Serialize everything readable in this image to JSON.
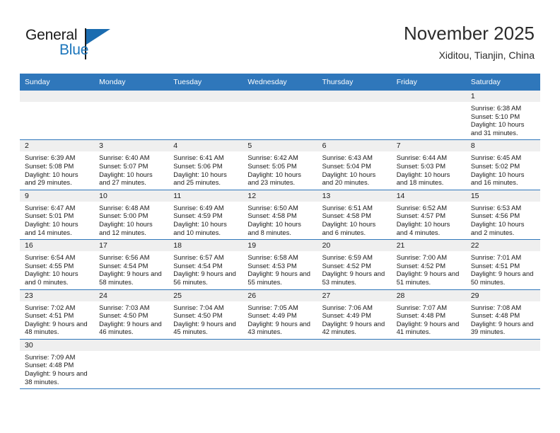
{
  "brand": {
    "line1": "General",
    "line2": "Blue",
    "flag_icon": "triangle-flag-icon",
    "color_text": "#1a1a1a",
    "color_blue": "#1b75bb"
  },
  "header": {
    "title": "November 2025",
    "subtitle": "Xiditou, Tianjin, China"
  },
  "theme": {
    "header_row_bg": "#2f77bb",
    "daynum_band_bg": "#efefef",
    "row_divider": "#2f77bb",
    "page_bg": "#ffffff"
  },
  "weekday_headers": [
    "Sunday",
    "Monday",
    "Tuesday",
    "Wednesday",
    "Thursday",
    "Friday",
    "Saturday"
  ],
  "labels": {
    "sunrise_prefix": "Sunrise:",
    "sunset_prefix": "Sunset:",
    "daylight_prefix": "Daylight:"
  },
  "weeks": [
    [
      {
        "blank": true,
        "day": "",
        "sunrise": "",
        "sunset": "",
        "daylight": ""
      },
      {
        "blank": true,
        "day": "",
        "sunrise": "",
        "sunset": "",
        "daylight": ""
      },
      {
        "blank": true,
        "day": "",
        "sunrise": "",
        "sunset": "",
        "daylight": ""
      },
      {
        "blank": true,
        "day": "",
        "sunrise": "",
        "sunset": "",
        "daylight": ""
      },
      {
        "blank": true,
        "day": "",
        "sunrise": "",
        "sunset": "",
        "daylight": ""
      },
      {
        "blank": true,
        "day": "",
        "sunrise": "",
        "sunset": "",
        "daylight": ""
      },
      {
        "blank": false,
        "day": "1",
        "sunrise": "Sunrise: 6:38 AM",
        "sunset": "Sunset: 5:10 PM",
        "daylight": "Daylight: 10 hours and 31 minutes."
      }
    ],
    [
      {
        "blank": false,
        "day": "2",
        "sunrise": "Sunrise: 6:39 AM",
        "sunset": "Sunset: 5:08 PM",
        "daylight": "Daylight: 10 hours and 29 minutes."
      },
      {
        "blank": false,
        "day": "3",
        "sunrise": "Sunrise: 6:40 AM",
        "sunset": "Sunset: 5:07 PM",
        "daylight": "Daylight: 10 hours and 27 minutes."
      },
      {
        "blank": false,
        "day": "4",
        "sunrise": "Sunrise: 6:41 AM",
        "sunset": "Sunset: 5:06 PM",
        "daylight": "Daylight: 10 hours and 25 minutes."
      },
      {
        "blank": false,
        "day": "5",
        "sunrise": "Sunrise: 6:42 AM",
        "sunset": "Sunset: 5:05 PM",
        "daylight": "Daylight: 10 hours and 23 minutes."
      },
      {
        "blank": false,
        "day": "6",
        "sunrise": "Sunrise: 6:43 AM",
        "sunset": "Sunset: 5:04 PM",
        "daylight": "Daylight: 10 hours and 20 minutes."
      },
      {
        "blank": false,
        "day": "7",
        "sunrise": "Sunrise: 6:44 AM",
        "sunset": "Sunset: 5:03 PM",
        "daylight": "Daylight: 10 hours and 18 minutes."
      },
      {
        "blank": false,
        "day": "8",
        "sunrise": "Sunrise: 6:45 AM",
        "sunset": "Sunset: 5:02 PM",
        "daylight": "Daylight: 10 hours and 16 minutes."
      }
    ],
    [
      {
        "blank": false,
        "day": "9",
        "sunrise": "Sunrise: 6:47 AM",
        "sunset": "Sunset: 5:01 PM",
        "daylight": "Daylight: 10 hours and 14 minutes."
      },
      {
        "blank": false,
        "day": "10",
        "sunrise": "Sunrise: 6:48 AM",
        "sunset": "Sunset: 5:00 PM",
        "daylight": "Daylight: 10 hours and 12 minutes."
      },
      {
        "blank": false,
        "day": "11",
        "sunrise": "Sunrise: 6:49 AM",
        "sunset": "Sunset: 4:59 PM",
        "daylight": "Daylight: 10 hours and 10 minutes."
      },
      {
        "blank": false,
        "day": "12",
        "sunrise": "Sunrise: 6:50 AM",
        "sunset": "Sunset: 4:58 PM",
        "daylight": "Daylight: 10 hours and 8 minutes."
      },
      {
        "blank": false,
        "day": "13",
        "sunrise": "Sunrise: 6:51 AM",
        "sunset": "Sunset: 4:58 PM",
        "daylight": "Daylight: 10 hours and 6 minutes."
      },
      {
        "blank": false,
        "day": "14",
        "sunrise": "Sunrise: 6:52 AM",
        "sunset": "Sunset: 4:57 PM",
        "daylight": "Daylight: 10 hours and 4 minutes."
      },
      {
        "blank": false,
        "day": "15",
        "sunrise": "Sunrise: 6:53 AM",
        "sunset": "Sunset: 4:56 PM",
        "daylight": "Daylight: 10 hours and 2 minutes."
      }
    ],
    [
      {
        "blank": false,
        "day": "16",
        "sunrise": "Sunrise: 6:54 AM",
        "sunset": "Sunset: 4:55 PM",
        "daylight": "Daylight: 10 hours and 0 minutes."
      },
      {
        "blank": false,
        "day": "17",
        "sunrise": "Sunrise: 6:56 AM",
        "sunset": "Sunset: 4:54 PM",
        "daylight": "Daylight: 9 hours and 58 minutes."
      },
      {
        "blank": false,
        "day": "18",
        "sunrise": "Sunrise: 6:57 AM",
        "sunset": "Sunset: 4:54 PM",
        "daylight": "Daylight: 9 hours and 56 minutes."
      },
      {
        "blank": false,
        "day": "19",
        "sunrise": "Sunrise: 6:58 AM",
        "sunset": "Sunset: 4:53 PM",
        "daylight": "Daylight: 9 hours and 55 minutes."
      },
      {
        "blank": false,
        "day": "20",
        "sunrise": "Sunrise: 6:59 AM",
        "sunset": "Sunset: 4:52 PM",
        "daylight": "Daylight: 9 hours and 53 minutes."
      },
      {
        "blank": false,
        "day": "21",
        "sunrise": "Sunrise: 7:00 AM",
        "sunset": "Sunset: 4:52 PM",
        "daylight": "Daylight: 9 hours and 51 minutes."
      },
      {
        "blank": false,
        "day": "22",
        "sunrise": "Sunrise: 7:01 AM",
        "sunset": "Sunset: 4:51 PM",
        "daylight": "Daylight: 9 hours and 50 minutes."
      }
    ],
    [
      {
        "blank": false,
        "day": "23",
        "sunrise": "Sunrise: 7:02 AM",
        "sunset": "Sunset: 4:51 PM",
        "daylight": "Daylight: 9 hours and 48 minutes."
      },
      {
        "blank": false,
        "day": "24",
        "sunrise": "Sunrise: 7:03 AM",
        "sunset": "Sunset: 4:50 PM",
        "daylight": "Daylight: 9 hours and 46 minutes."
      },
      {
        "blank": false,
        "day": "25",
        "sunrise": "Sunrise: 7:04 AM",
        "sunset": "Sunset: 4:50 PM",
        "daylight": "Daylight: 9 hours and 45 minutes."
      },
      {
        "blank": false,
        "day": "26",
        "sunrise": "Sunrise: 7:05 AM",
        "sunset": "Sunset: 4:49 PM",
        "daylight": "Daylight: 9 hours and 43 minutes."
      },
      {
        "blank": false,
        "day": "27",
        "sunrise": "Sunrise: 7:06 AM",
        "sunset": "Sunset: 4:49 PM",
        "daylight": "Daylight: 9 hours and 42 minutes."
      },
      {
        "blank": false,
        "day": "28",
        "sunrise": "Sunrise: 7:07 AM",
        "sunset": "Sunset: 4:48 PM",
        "daylight": "Daylight: 9 hours and 41 minutes."
      },
      {
        "blank": false,
        "day": "29",
        "sunrise": "Sunrise: 7:08 AM",
        "sunset": "Sunset: 4:48 PM",
        "daylight": "Daylight: 9 hours and 39 minutes."
      }
    ],
    [
      {
        "blank": false,
        "day": "30",
        "sunrise": "Sunrise: 7:09 AM",
        "sunset": "Sunset: 4:48 PM",
        "daylight": "Daylight: 9 hours and 38 minutes."
      },
      {
        "blank": true,
        "day": "",
        "sunrise": "",
        "sunset": "",
        "daylight": ""
      },
      {
        "blank": true,
        "day": "",
        "sunrise": "",
        "sunset": "",
        "daylight": ""
      },
      {
        "blank": true,
        "day": "",
        "sunrise": "",
        "sunset": "",
        "daylight": ""
      },
      {
        "blank": true,
        "day": "",
        "sunrise": "",
        "sunset": "",
        "daylight": ""
      },
      {
        "blank": true,
        "day": "",
        "sunrise": "",
        "sunset": "",
        "daylight": ""
      },
      {
        "blank": true,
        "day": "",
        "sunrise": "",
        "sunset": "",
        "daylight": ""
      }
    ]
  ]
}
